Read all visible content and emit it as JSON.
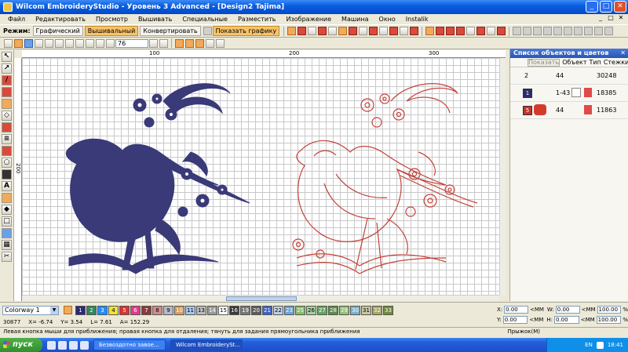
{
  "window": {
    "title": "Wilcom EmbroideryStudio - Уровень 3 Advanced - [Design2        Tajima]",
    "controls": [
      "_",
      "□",
      "✕"
    ]
  },
  "menubar": {
    "items": [
      "Файл",
      "Редактировать",
      "Просмотр",
      "Вышивать",
      "Специальные",
      "Разместить",
      "Изображение",
      "Машина",
      "Окно",
      "Instalik"
    ]
  },
  "toolbar": {
    "mode_label": "Режим:",
    "mode_graphic": "Графический",
    "mode_embroidery": "Вышивальный",
    "mode_convert": "Конвертировать",
    "show_graphics": "Показать графику",
    "zoom_value": "76"
  },
  "ruler": {
    "top_labels": [
      "100",
      "200",
      "300"
    ],
    "left_labels": [
      "200"
    ]
  },
  "panel": {
    "title": "Список объектов и цветов",
    "show_button": "Показать",
    "col_object": "Объект",
    "col_type": "Тип",
    "col_stitches": "Стежки",
    "rows": [
      {
        "index": "2",
        "count": "44",
        "stitches": "30248"
      },
      {
        "index": "1",
        "count": "1-43",
        "stitches": "18385",
        "swatch_color": "#2d2b6e"
      },
      {
        "index": "5",
        "count": "44",
        "stitches": "11863",
        "swatch_color": "#c3332b"
      }
    ]
  },
  "colorbar": {
    "colorway": "Colorway 1",
    "chips": [
      {
        "n": "1",
        "c": "#2a2a78"
      },
      {
        "n": "2",
        "c": "#2e8b57"
      },
      {
        "n": "3",
        "c": "#1e90ff"
      },
      {
        "n": "4",
        "c": "#f2e13a"
      },
      {
        "n": "5",
        "c": "#d9342b"
      },
      {
        "n": "6",
        "c": "#e7368f"
      },
      {
        "n": "7",
        "c": "#8b3a3a"
      },
      {
        "n": "8",
        "c": "#d38b8b"
      },
      {
        "n": "9",
        "c": "#b9b9c8"
      },
      {
        "n": "10",
        "c": "#d8a060"
      },
      {
        "n": "11",
        "c": "#a9c7e8"
      },
      {
        "n": "13",
        "c": "#bcbcbc"
      },
      {
        "n": "14",
        "c": "#9a9a9a"
      },
      {
        "n": "15",
        "c": "#ffffff"
      },
      {
        "n": "16",
        "c": "#3a3a3a"
      },
      {
        "n": "19",
        "c": "#787878"
      },
      {
        "n": "20",
        "c": "#5a5a5a"
      },
      {
        "n": "21",
        "c": "#3e62c9"
      },
      {
        "n": "22",
        "c": "#c0d0e8"
      },
      {
        "n": "23",
        "c": "#6aa4d8"
      },
      {
        "n": "25",
        "c": "#8abd6a"
      },
      {
        "n": "26",
        "c": "#a6cfa0"
      },
      {
        "n": "27",
        "c": "#63a85c"
      },
      {
        "n": "28",
        "c": "#5c8c48"
      },
      {
        "n": "29",
        "c": "#93c17a"
      },
      {
        "n": "30",
        "c": "#7db0c8"
      },
      {
        "n": "31",
        "c": "#c8c8a0"
      },
      {
        "n": "32",
        "c": "#a8a860"
      },
      {
        "n": "33",
        "c": "#708a3c"
      }
    ]
  },
  "coords": {
    "x_label": "X:",
    "x_value": "0.00",
    "x_unit": "<MM",
    "y_label": "Y:",
    "y_value": "0.00",
    "y_unit": "<MM",
    "w_label": "W:",
    "w_value": "0.00",
    "w_unit": "<MM",
    "h_label": "H:",
    "h_value": "0.00",
    "h_unit": "<MM",
    "wp_value": "100.00",
    "hp_value": "100.00",
    "pct": "%"
  },
  "status": {
    "stitch_count": "30877",
    "x": "X= -6.74",
    "y": "Y= 3.54",
    "l": "L= 7.61",
    "a": "A= 152.29",
    "hint": "Левая кнопка мыши для приближения; правая кнопка для отдаления; тянуть для задания прямоугольника приближения",
    "mode": "Прыжок(M)"
  },
  "taskbar": {
    "start_label": "пуск",
    "tasks": [
      "Безвоздотно завое...",
      "Wilcom EmbroiderySt..."
    ],
    "lang": "EN",
    "clock": "18:41"
  },
  "colors": {
    "design_blue": "#3a3a78",
    "design_red": "#c2423a"
  }
}
